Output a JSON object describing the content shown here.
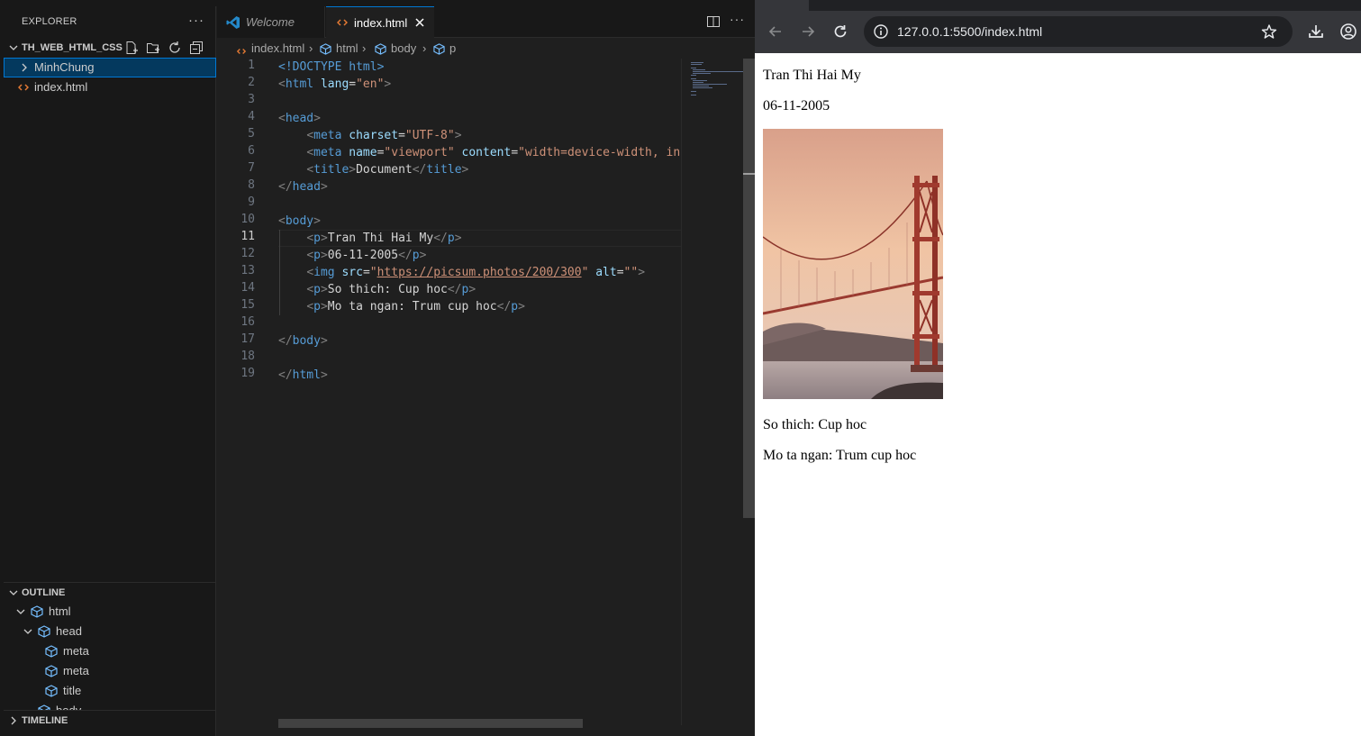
{
  "vscode": {
    "explorer": {
      "title": "EXPLORER",
      "more_label": "···",
      "workspace": "TH_WEB_HTML_CSS",
      "tree": [
        {
          "label": "MinhChung",
          "kind": "folder"
        },
        {
          "label": "index.html",
          "kind": "html-file"
        }
      ]
    },
    "outline": {
      "title": "OUTLINE",
      "items": [
        {
          "label": "html",
          "depth": 0,
          "expanded": true
        },
        {
          "label": "head",
          "depth": 1,
          "expanded": true
        },
        {
          "label": "meta",
          "depth": 2
        },
        {
          "label": "meta",
          "depth": 2
        },
        {
          "label": "title",
          "depth": 2
        },
        {
          "label": "body",
          "depth": 1,
          "expanded": true
        }
      ]
    },
    "timeline": {
      "title": "TIMELINE"
    },
    "tabs": [
      {
        "label": "Welcome",
        "icon": "vscode-logo-icon",
        "active": false
      },
      {
        "label": "index.html",
        "icon": "html-file-icon",
        "active": true
      }
    ],
    "breadcrumb": [
      "index.html",
      "html",
      "body",
      "p"
    ],
    "current_line": 11,
    "line_numbers": [
      "1",
      "2",
      "3",
      "4",
      "5",
      "6",
      "7",
      "8",
      "9",
      "10",
      "11",
      "12",
      "13",
      "14",
      "15",
      "16",
      "17",
      "18",
      "19"
    ],
    "code_text": {
      "doctype": "<!DOCTYPE html>",
      "html_open": "html",
      "lang_attr": "lang",
      "lang_val": "\"en\"",
      "head": "head",
      "meta": "meta",
      "charset_attr": "charset",
      "charset_val": "\"UTF-8\"",
      "name_attr": "name",
      "name_val": "\"viewport\"",
      "content_attr": "content",
      "content_val": "\"width=device-width, init",
      "title": "title",
      "title_text": "Document",
      "body": "body",
      "p": "p",
      "p1_text": "Tran Thi Hai My",
      "p2_text": "06-11-2005",
      "img": "img",
      "src_attr": "src",
      "src_val": "https://picsum.photos/200/300",
      "alt_attr": "alt",
      "alt_val": "\"\"",
      "p3_text": "So thich: Cup hoc",
      "p4_text": "Mo ta ngan: Trum cup hoc"
    },
    "colors": {
      "accent": "#0078d4",
      "tag": "#569cd6",
      "attr": "#9cdcfe",
      "string": "#ce9178"
    }
  },
  "browser": {
    "url": "127.0.0.1:5500/index.html",
    "page": {
      "name": "Tran Thi Hai My",
      "date": "06-11-2005",
      "image_alt": "",
      "hobby": "So thich: Cup hoc",
      "description": "Mo ta ngan: Trum cup hoc"
    }
  }
}
